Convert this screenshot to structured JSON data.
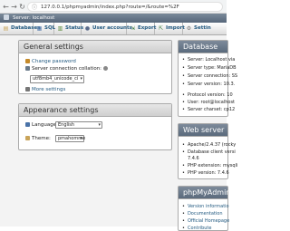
{
  "browser": {
    "url": "127.0.0.1/phpmyadmin/index.php?route=/&route=%2F"
  },
  "breadcrumb": {
    "text": "Server: localhost"
  },
  "tabs": [
    {
      "label": "Databases",
      "icon": "database-icon",
      "color": "#c9a45a"
    },
    {
      "label": "SQL",
      "icon": "sql-icon",
      "color": "#4a73a8"
    },
    {
      "label": "Status",
      "icon": "status-icon",
      "color": "#5a8a3a"
    },
    {
      "label": "User accounts",
      "icon": "users-icon",
      "color": "#5a6a8a"
    },
    {
      "label": "Export",
      "icon": "export-icon",
      "color": "#3a7a3a"
    },
    {
      "label": "Import",
      "icon": "import-icon",
      "color": "#3a7a3a"
    },
    {
      "label": "Settin",
      "icon": "settings-icon",
      "color": "#777777"
    }
  ],
  "general_settings": {
    "title": "General settings",
    "change_password": "Change password",
    "collation_label": "Server connection collation:",
    "collation_value": "utf8mb4_unicode_ci",
    "more_settings": "More settings"
  },
  "appearance_settings": {
    "title": "Appearance settings",
    "language_label": "Language",
    "language_value": "English",
    "theme_label": "Theme:",
    "theme_value": "pmahomme"
  },
  "database_server": {
    "title": "Database serv",
    "items": [
      "Server: Localhost via",
      "Server type: MariaDB",
      "Server connection: SS",
      "Server version: 10.3.",
      "Protocol version: 10",
      "User: root@localhost",
      "Server charset: cp12"
    ]
  },
  "web_server": {
    "title": "Web server",
    "items": [
      {
        "text": "Apache/2.4.37 (rocky",
        "indent": false
      },
      {
        "text": "Database client versi",
        "indent": false
      },
      {
        "text": "7.4.6",
        "indent": true
      },
      {
        "text": "PHP extension: mysqli",
        "indent": false
      },
      {
        "text": "PHP version: 7.4.6",
        "indent": false
      }
    ]
  },
  "phpmyadmin": {
    "title": "phpMyAdmin",
    "items": [
      "Version informatio",
      "Documentation",
      "Official Homepage",
      "Contribute"
    ]
  }
}
